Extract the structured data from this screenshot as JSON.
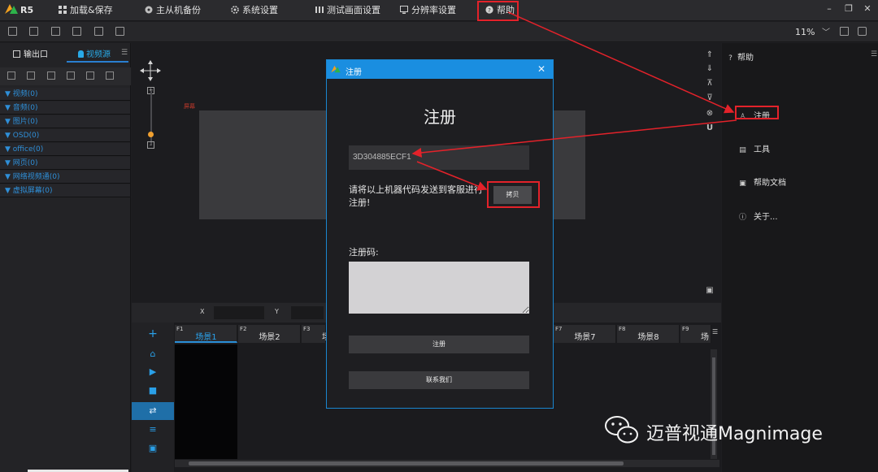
{
  "app": {
    "logo": "R5"
  },
  "menu": {
    "load_save": "加载&保存",
    "backup": "主从机备份",
    "system": "系统设置",
    "test_pattern": "测试画面设置",
    "resolution": "分辨率设置",
    "help": "帮助"
  },
  "toolbar": {
    "zoom": "11%"
  },
  "left_panel": {
    "tabs": [
      "输出口",
      "视频源"
    ],
    "categories": [
      "▼ 视频(0)",
      "▼ 音频(0)",
      "▼ 图片(0)",
      "▼ OSD(0)",
      "▼ office(0)",
      "▼ 网页(0)",
      "▼ 网络视频通(0)",
      "▼ 虚拟屏幕(0)"
    ]
  },
  "canvas": {
    "screen_label": "屏幕"
  },
  "xy_bar": {
    "x_label": "X",
    "y_label": "Y"
  },
  "scenes": [
    {
      "key": "F1",
      "name": "场景1"
    },
    {
      "key": "F2",
      "name": "场景2"
    },
    {
      "key": "F3",
      "name": "场"
    },
    {
      "key": "F7",
      "name": "场景7"
    },
    {
      "key": "F8",
      "name": "场景8"
    },
    {
      "key": "F9",
      "name": "场"
    }
  ],
  "right_panel": {
    "title": "帮助",
    "items": [
      "注册",
      "工具",
      "帮助文档",
      "关于..."
    ]
  },
  "dialog": {
    "title": "注册",
    "heading": "注册",
    "machine_code": "3D304885ECF1",
    "instruction_line1": "请将以上机器代码发送到客服进行",
    "instruction_line2": "注册!",
    "copy_button": "拷贝",
    "regcode_label": "注册码:",
    "regcode_value": "",
    "register_button": "注册",
    "contact_button": "联系我们"
  },
  "watermark": "迈普视通Magnimage",
  "colors": {
    "accent": "#1a8ee0",
    "annotation": "#e3222a"
  }
}
